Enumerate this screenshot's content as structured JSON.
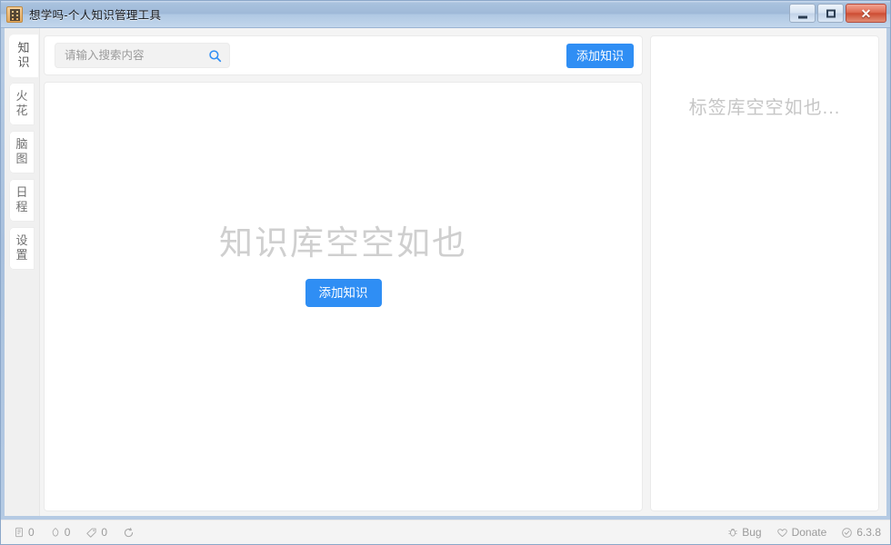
{
  "window": {
    "title": "想学吗-个人知识管理工具",
    "app_icon": "app-logo-icon",
    "controls": {
      "minimize": "minimize-icon",
      "maximize": "maximize-icon",
      "close": "✕"
    }
  },
  "sidebar": {
    "tabs": [
      {
        "label": "知识",
        "chars": [
          "知",
          "识"
        ],
        "active": true
      },
      {
        "label": "火花",
        "chars": [
          "火",
          "花"
        ],
        "active": false
      },
      {
        "label": "脑图",
        "chars": [
          "脑",
          "图"
        ],
        "active": false
      },
      {
        "label": "日程",
        "chars": [
          "日",
          "程"
        ],
        "active": false
      },
      {
        "label": "设置",
        "chars": [
          "设",
          "置"
        ],
        "active": false
      }
    ]
  },
  "toolbar": {
    "search": {
      "value": "",
      "placeholder": "请输入搜索内容",
      "icon": "search-icon"
    },
    "add_button_label": "添加知识"
  },
  "main": {
    "empty_title": "知识库空空如也",
    "empty_button_label": "添加知识"
  },
  "tag_panel": {
    "empty_text": "标签库空空如也..."
  },
  "statusbar": {
    "counters": [
      {
        "icon": "document-icon",
        "value": "0"
      },
      {
        "icon": "spark-icon",
        "value": "0"
      },
      {
        "icon": "tag-icon",
        "value": "0"
      }
    ],
    "refresh_icon": "refresh-icon",
    "links": [
      {
        "icon": "bug-icon",
        "label": "Bug"
      },
      {
        "icon": "heart-icon",
        "label": "Donate"
      },
      {
        "icon": "check-circle-icon",
        "label": "6.3.8"
      }
    ]
  },
  "colors": {
    "accent": "#2f8ef4",
    "title_bar": "#a9c2de",
    "close_button": "#cd4d33",
    "empty_text": "#cfcfcf"
  }
}
